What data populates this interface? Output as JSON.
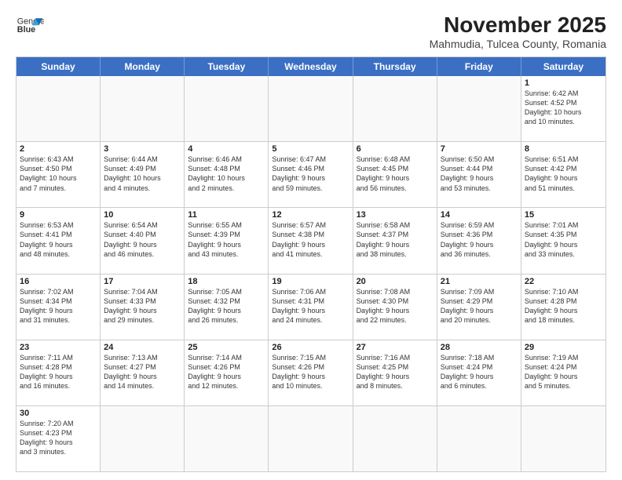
{
  "header": {
    "logo_text_normal": "General",
    "logo_text_bold": "Blue",
    "title": "November 2025",
    "subtitle": "Mahmudia, Tulcea County, Romania"
  },
  "calendar": {
    "days_of_week": [
      "Sunday",
      "Monday",
      "Tuesday",
      "Wednesday",
      "Thursday",
      "Friday",
      "Saturday"
    ],
    "rows": [
      [
        {
          "num": "",
          "info": ""
        },
        {
          "num": "",
          "info": ""
        },
        {
          "num": "",
          "info": ""
        },
        {
          "num": "",
          "info": ""
        },
        {
          "num": "",
          "info": ""
        },
        {
          "num": "",
          "info": ""
        },
        {
          "num": "1",
          "info": "Sunrise: 6:42 AM\nSunset: 4:52 PM\nDaylight: 10 hours\nand 10 minutes."
        }
      ],
      [
        {
          "num": "2",
          "info": "Sunrise: 6:43 AM\nSunset: 4:50 PM\nDaylight: 10 hours\nand 7 minutes."
        },
        {
          "num": "3",
          "info": "Sunrise: 6:44 AM\nSunset: 4:49 PM\nDaylight: 10 hours\nand 4 minutes."
        },
        {
          "num": "4",
          "info": "Sunrise: 6:46 AM\nSunset: 4:48 PM\nDaylight: 10 hours\nand 2 minutes."
        },
        {
          "num": "5",
          "info": "Sunrise: 6:47 AM\nSunset: 4:46 PM\nDaylight: 9 hours\nand 59 minutes."
        },
        {
          "num": "6",
          "info": "Sunrise: 6:48 AM\nSunset: 4:45 PM\nDaylight: 9 hours\nand 56 minutes."
        },
        {
          "num": "7",
          "info": "Sunrise: 6:50 AM\nSunset: 4:44 PM\nDaylight: 9 hours\nand 53 minutes."
        },
        {
          "num": "8",
          "info": "Sunrise: 6:51 AM\nSunset: 4:42 PM\nDaylight: 9 hours\nand 51 minutes."
        }
      ],
      [
        {
          "num": "9",
          "info": "Sunrise: 6:53 AM\nSunset: 4:41 PM\nDaylight: 9 hours\nand 48 minutes."
        },
        {
          "num": "10",
          "info": "Sunrise: 6:54 AM\nSunset: 4:40 PM\nDaylight: 9 hours\nand 46 minutes."
        },
        {
          "num": "11",
          "info": "Sunrise: 6:55 AM\nSunset: 4:39 PM\nDaylight: 9 hours\nand 43 minutes."
        },
        {
          "num": "12",
          "info": "Sunrise: 6:57 AM\nSunset: 4:38 PM\nDaylight: 9 hours\nand 41 minutes."
        },
        {
          "num": "13",
          "info": "Sunrise: 6:58 AM\nSunset: 4:37 PM\nDaylight: 9 hours\nand 38 minutes."
        },
        {
          "num": "14",
          "info": "Sunrise: 6:59 AM\nSunset: 4:36 PM\nDaylight: 9 hours\nand 36 minutes."
        },
        {
          "num": "15",
          "info": "Sunrise: 7:01 AM\nSunset: 4:35 PM\nDaylight: 9 hours\nand 33 minutes."
        }
      ],
      [
        {
          "num": "16",
          "info": "Sunrise: 7:02 AM\nSunset: 4:34 PM\nDaylight: 9 hours\nand 31 minutes."
        },
        {
          "num": "17",
          "info": "Sunrise: 7:04 AM\nSunset: 4:33 PM\nDaylight: 9 hours\nand 29 minutes."
        },
        {
          "num": "18",
          "info": "Sunrise: 7:05 AM\nSunset: 4:32 PM\nDaylight: 9 hours\nand 26 minutes."
        },
        {
          "num": "19",
          "info": "Sunrise: 7:06 AM\nSunset: 4:31 PM\nDaylight: 9 hours\nand 24 minutes."
        },
        {
          "num": "20",
          "info": "Sunrise: 7:08 AM\nSunset: 4:30 PM\nDaylight: 9 hours\nand 22 minutes."
        },
        {
          "num": "21",
          "info": "Sunrise: 7:09 AM\nSunset: 4:29 PM\nDaylight: 9 hours\nand 20 minutes."
        },
        {
          "num": "22",
          "info": "Sunrise: 7:10 AM\nSunset: 4:28 PM\nDaylight: 9 hours\nand 18 minutes."
        }
      ],
      [
        {
          "num": "23",
          "info": "Sunrise: 7:11 AM\nSunset: 4:28 PM\nDaylight: 9 hours\nand 16 minutes."
        },
        {
          "num": "24",
          "info": "Sunrise: 7:13 AM\nSunset: 4:27 PM\nDaylight: 9 hours\nand 14 minutes."
        },
        {
          "num": "25",
          "info": "Sunrise: 7:14 AM\nSunset: 4:26 PM\nDaylight: 9 hours\nand 12 minutes."
        },
        {
          "num": "26",
          "info": "Sunrise: 7:15 AM\nSunset: 4:26 PM\nDaylight: 9 hours\nand 10 minutes."
        },
        {
          "num": "27",
          "info": "Sunrise: 7:16 AM\nSunset: 4:25 PM\nDaylight: 9 hours\nand 8 minutes."
        },
        {
          "num": "28",
          "info": "Sunrise: 7:18 AM\nSunset: 4:24 PM\nDaylight: 9 hours\nand 6 minutes."
        },
        {
          "num": "29",
          "info": "Sunrise: 7:19 AM\nSunset: 4:24 PM\nDaylight: 9 hours\nand 5 minutes."
        }
      ],
      [
        {
          "num": "30",
          "info": "Sunrise: 7:20 AM\nSunset: 4:23 PM\nDaylight: 9 hours\nand 3 minutes."
        },
        {
          "num": "",
          "info": ""
        },
        {
          "num": "",
          "info": ""
        },
        {
          "num": "",
          "info": ""
        },
        {
          "num": "",
          "info": ""
        },
        {
          "num": "",
          "info": ""
        },
        {
          "num": "",
          "info": ""
        }
      ]
    ]
  }
}
